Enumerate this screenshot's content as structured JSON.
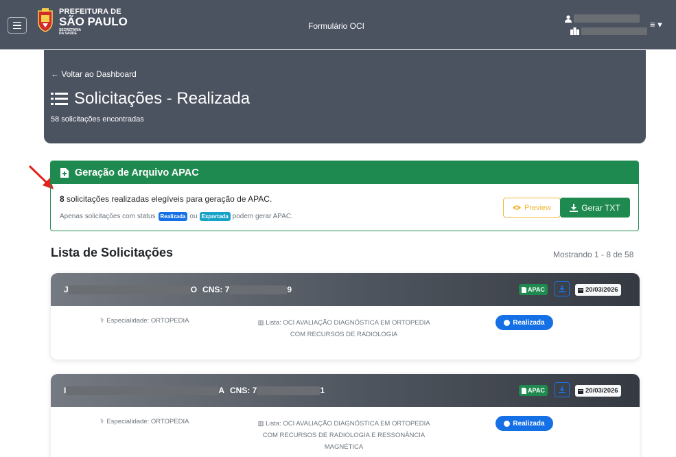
{
  "navbar": {
    "menu_icon": "hamburger-icon",
    "logo": {
      "line1": "PREFEITURA DE",
      "line2": "SÃO PAULO",
      "line3": "SECRETARIA",
      "line4": "DA SAÚDE"
    },
    "title": "Formulário OCI",
    "user_icon": "user-icon",
    "unit_icon": "hospital-icon",
    "user_menu_icon": "list-caret-icon"
  },
  "header": {
    "back_label": "← Voltar ao Dashboard",
    "title": "Solicitações - Realizada",
    "subtitle": "58 solicitações encontradas"
  },
  "apac": {
    "title": "Geração de Arquivo APAC",
    "count": "8",
    "count_text": " solicitações realizadas elegíveis para geração de APAC.",
    "note_prefix": "Apenas solicitações com status",
    "pill_realizada": "Realizada",
    "note_mid": "ou",
    "pill_exportada": "Exportada",
    "note_suffix": "podem gerar APAC.",
    "preview_label": "Preview",
    "gerar_label": "Gerar TXT",
    "colors": {
      "green": "#1f8a50",
      "preview": "#f3b73b",
      "realizada": "#1570e6",
      "exportada": "#17a2c8"
    }
  },
  "list": {
    "title": "Lista de Solicitações",
    "count": "Mostrando 1 - 8 de 58",
    "items": [
      {
        "name_first": "J",
        "name_last": "O",
        "cns_label": "CNS: 7",
        "cns_last": "9",
        "apac_label": "APAC",
        "date": "20/03/2026",
        "especialidade": "Especialidade: ORTOPEDIA",
        "lista": "Lista: OCI AVALIAÇÃO DIAGNÓSTICA EM ORTOPEDIA COM RECURSOS DE RADIOLOGIA",
        "status": "Realizada"
      },
      {
        "name_first": "I",
        "name_last": "A",
        "cns_label": "CNS: 7",
        "cns_last": "1",
        "apac_label": "APAC",
        "date": "20/03/2026",
        "especialidade": "Especialidade: ORTOPEDIA",
        "lista": "Lista: OCI AVALIAÇÃO DIAGNÓSTICA EM ORTOPEDIA COM RECURSOS DE RADIOLOGIA E RESSONÂNCIA MAGNÉTICA",
        "status": "Realizada"
      }
    ]
  }
}
